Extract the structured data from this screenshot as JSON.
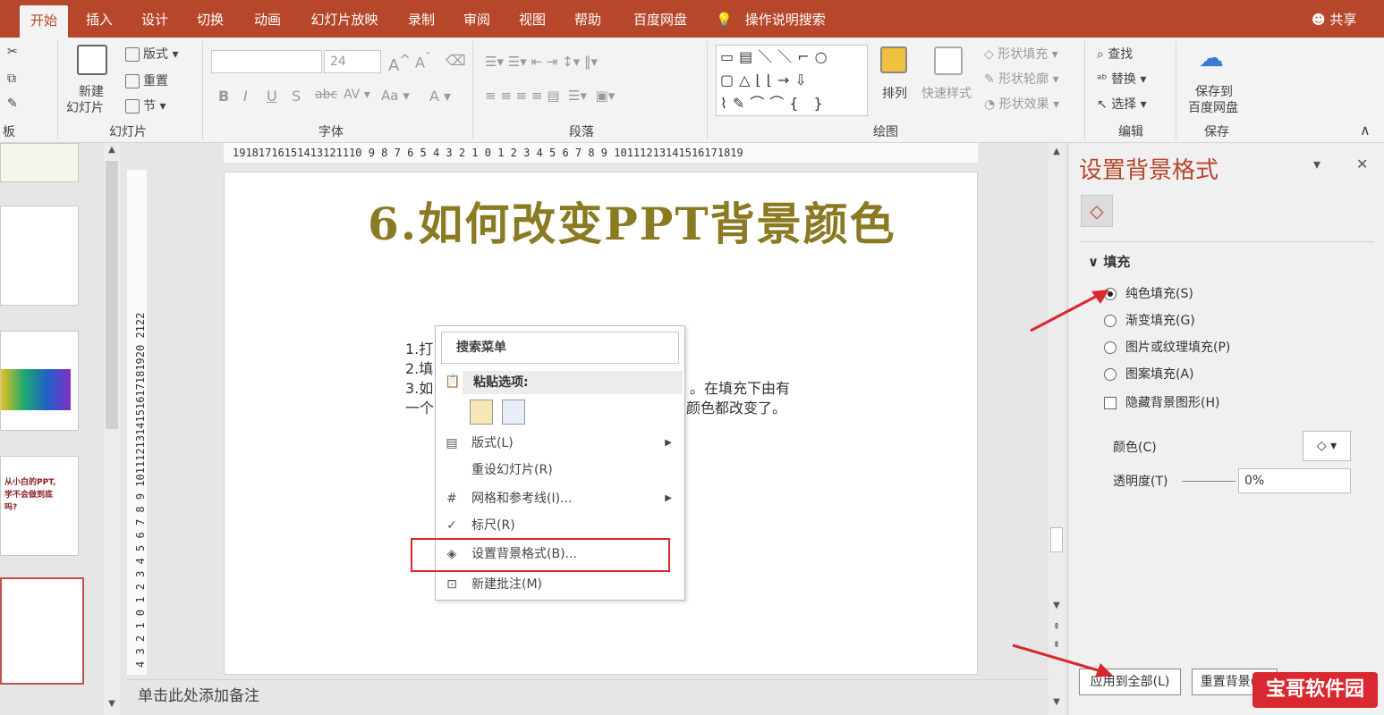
{
  "tabs": [
    "开始",
    "插入",
    "设计",
    "切换",
    "动画",
    "幻灯片放映",
    "录制",
    "审阅",
    "视图",
    "帮助",
    "百度网盘"
  ],
  "tell_me": "操作说明搜索",
  "share": "共享",
  "ribbon": {
    "clipboard_label": "板",
    "new_slide": [
      "新建",
      "幻灯片"
    ],
    "layout": "版式",
    "reset": "重置",
    "section": "节",
    "slides_group": "幻灯片",
    "font_size": "24",
    "font_group": "字体",
    "paragraph_group": "段落",
    "arrange": "排列",
    "quick_styles": "快速样式",
    "shape_fill": "形状填充",
    "shape_outline": "形状轮廓",
    "shape_effects": "形状效果",
    "drawing_group": "绘图",
    "find": "查找",
    "replace": "替换",
    "select": "选择",
    "editing_group": "编辑",
    "save_to": [
      "保存到",
      "百度网盘"
    ],
    "save_group": "保存"
  },
  "ruler_h": "19181716151413121110 9 8 7 6 5 4 3 2 1 0 1 2 3 4 5 6 7 8 9 10111213141516171819",
  "ruler_v": "4 3 2 1 0 1 2 3 4 5 6 7 8 9 1011121314151617181920 2122",
  "slide": {
    "title": "6.如何改变PPT背景颜色",
    "lines": [
      "1.打",
      "2.填",
      "3.如",
      "一个"
    ],
    "line_right_1": "。在填充下由有",
    "line_right_2": "颜色都改变了。"
  },
  "context_menu": {
    "search": "搜索菜单",
    "paste_header": "粘贴选项:",
    "items": [
      "版式(L)",
      "重设幻灯片(R)",
      "网格和参考线(I)...",
      "标尺(R)",
      "设置背景格式(B)...",
      "新建批注(M)"
    ]
  },
  "pane": {
    "title": "设置背景格式",
    "section": "填充",
    "options": [
      "纯色填充(S)",
      "渐变填充(G)",
      "图片或纹理填充(P)",
      "图案填充(A)"
    ],
    "hide_graphics": "隐藏背景图形(H)",
    "color_label": "颜色(C)",
    "transparency_label": "透明度(T)",
    "transparency_value": "0%",
    "apply_all": "应用到全部(L)",
    "reset_bg": "重置背景(B)"
  },
  "notes": "单击此处添加备注",
  "thumb_texts": {
    "t5_line1": "从小白的PPT,",
    "t5_line2": "学不会做到底",
    "t5_line3": "吗?"
  },
  "watermark": "宝哥软件园",
  "colors": {
    "accent": "#b7472a",
    "title": "#8a7a22",
    "highlight": "#d9282f"
  }
}
